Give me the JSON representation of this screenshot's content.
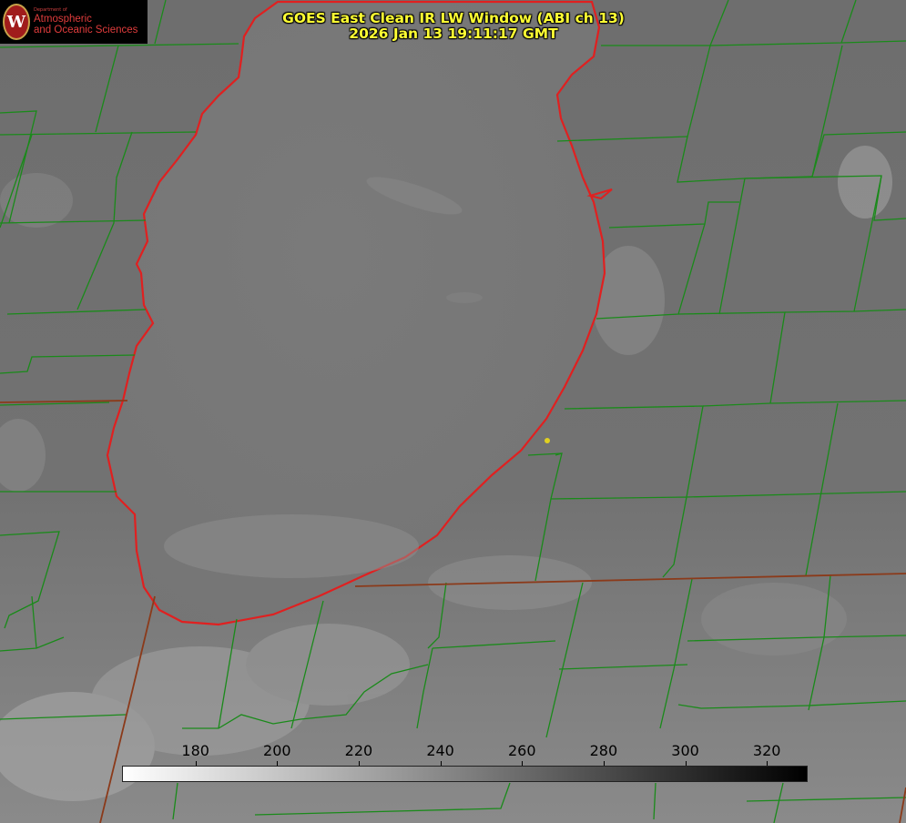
{
  "header": {
    "title_line1": "GOES East Clean IR LW Window (ABI ch 13)",
    "title_line2": "2026 Jan 13 19:11:17 GMT"
  },
  "logo": {
    "seal_letter": "W",
    "small": "Department of",
    "line1": "Atmospheric",
    "line2": "and Oceanic Sciences",
    "color": "#e03c3c"
  },
  "colorbar": {
    "ticks": [
      "180",
      "200",
      "220",
      "240",
      "260",
      "280",
      "300",
      "320"
    ],
    "range": [
      162,
      330
    ],
    "colors": {
      "low": "#ffffff",
      "high": "#000000"
    }
  },
  "map": {
    "colors": {
      "county_lines": "#1a8a1a",
      "state_lines": "#8b3a1a",
      "shoreline": "#e02020",
      "marker": "#e0d020"
    }
  }
}
